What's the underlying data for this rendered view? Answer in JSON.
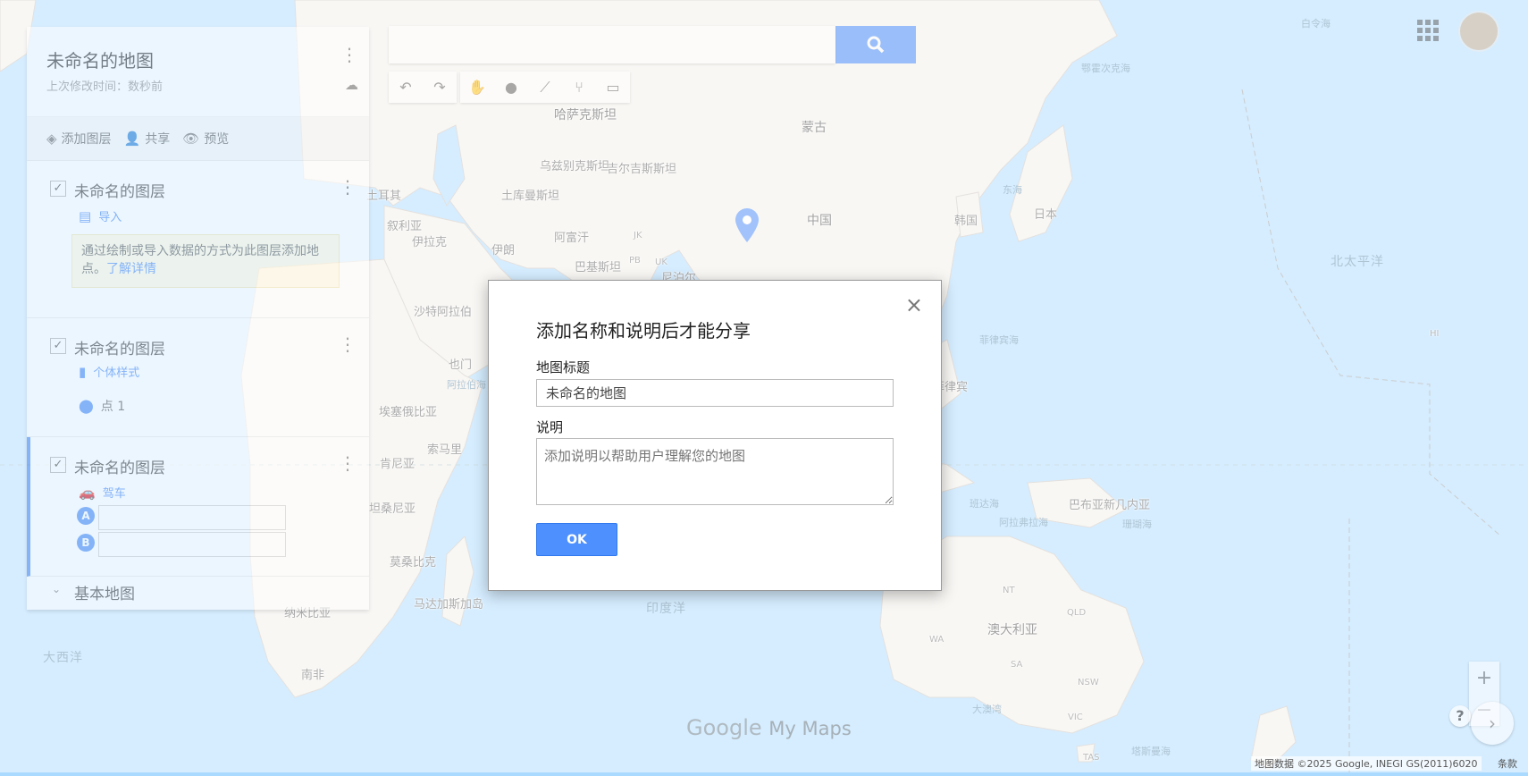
{
  "map": {
    "labels": {
      "kazakhstan": "哈萨克斯坦",
      "mongolia": "蒙古",
      "uzbekistan": "乌兹别克斯坦",
      "kyrgyzstan": "吉尔吉斯斯坦",
      "turkmenistan": "土库曼斯坦",
      "turkey": "土耳其",
      "syria": "叙利亚",
      "iraq": "伊拉克",
      "iran": "伊朗",
      "afghanistan": "阿富汗",
      "pakistan": "巴基斯坦",
      "nepal": "尼泊尔",
      "china": "中国",
      "korea": "韩国",
      "japan": "日本",
      "saudi": "沙特阿拉伯",
      "yemen": "也门",
      "ethiopia": "埃塞俄比亚",
      "somalia": "索马里",
      "kenya": "肯尼亚",
      "tanzania": "坦桑尼亚",
      "mozambique": "莫桑比克",
      "madagascar": "马达加斯加岛",
      "namibia": "纳米比亚",
      "south_africa": "南非",
      "png": "巴布亚新几内亚",
      "australia": "澳大利亚",
      "philippines": "菲律宾",
      "north_pacific": "北太平洋",
      "indian_ocean": "印度洋",
      "atlantic": "大西洋",
      "okhotsk": "鄂霍次克海",
      "east_sea": "东海",
      "south_china_sea": "南海",
      "philippine_sea": "菲律宾海",
      "arafura": "阿拉弗拉海",
      "banda": "班达海",
      "coral_sea": "珊瑚海",
      "great_bight": "大澳湾",
      "tasman": "塔斯曼海",
      "bering": "白令海",
      "arabian_sea": "阿拉伯海",
      "nt": "NT",
      "qld": "QLD",
      "wa": "WA",
      "sa": "SA",
      "nsw": "NSW",
      "vic": "VIC",
      "tas": "TAS",
      "hi": "HI",
      "jk": "JK",
      "pb": "PB",
      "uk": "UK"
    }
  },
  "panel": {
    "title": "未命名的地图",
    "subtitle": "上次修改时间：数秒前",
    "toolbar": {
      "add_layer": "添加图层",
      "share": "共享",
      "preview": "预览"
    },
    "layers": [
      {
        "name": "未命名的图层",
        "action": "导入",
        "hint_text": "通过绘制或导入数据的方式为此图层添加地点。",
        "hint_link": "了解详情"
      },
      {
        "name": "未命名的图层",
        "style": "个体样式",
        "point": "点 1"
      },
      {
        "name": "未命名的图层",
        "mode": "驾车",
        "a": "A",
        "b": "B"
      }
    ],
    "basemap": "基本地图"
  },
  "search": {
    "placeholder": ""
  },
  "brand": {
    "google": "Google",
    "mymaps": "My Maps"
  },
  "attribution": "地图数据 ©2025 Google, INEGI GS(2011)6020",
  "terms": "条款",
  "dialog": {
    "title": "添加名称和说明后才能分享",
    "name_label": "地图标题",
    "name_value": "未命名的地图",
    "desc_label": "说明",
    "desc_placeholder": "添加说明以帮助用户理解您的地图",
    "ok": "OK",
    "close": "×"
  },
  "colors": {
    "water": "#aadaff",
    "land": "#f2efe9",
    "accent": "#4d90fe",
    "pin": "#4285f4"
  }
}
